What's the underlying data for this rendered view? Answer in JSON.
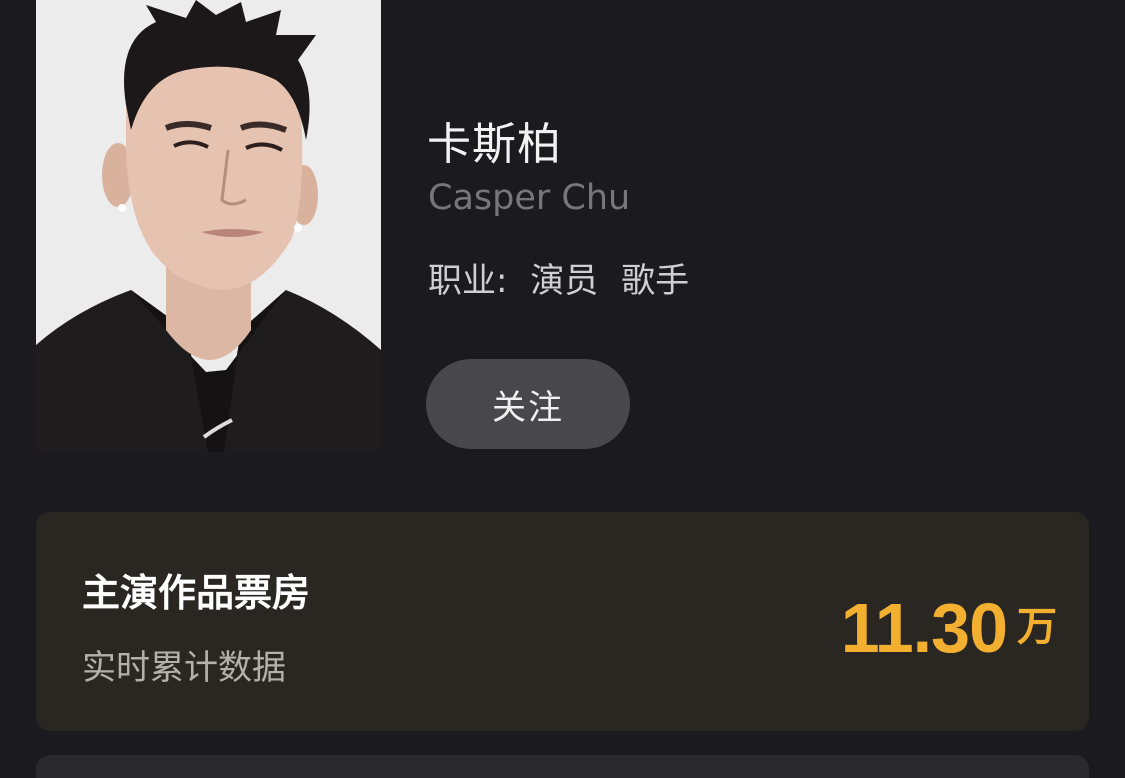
{
  "profile": {
    "name": "卡斯柏",
    "name_en": "Casper Chu",
    "profession_label": "职业:",
    "professions": [
      "演员",
      "歌手"
    ],
    "follow_label": "关注"
  },
  "box_office": {
    "title": "主演作品票房",
    "subtitle": "实时累计数据",
    "value": "11.30",
    "unit": "万"
  },
  "colors": {
    "background": "#1b1a1f",
    "accent": "#f3b030",
    "card": "#2a2723",
    "button": "#48474c"
  }
}
